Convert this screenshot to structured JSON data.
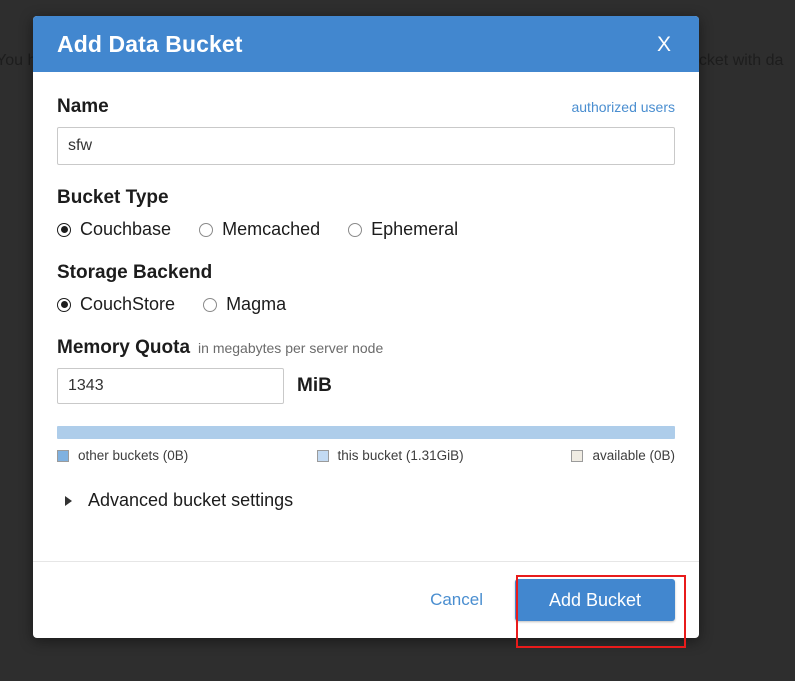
{
  "background": {
    "text_left": "You h",
    "text_right": "ucket with da",
    "overlay_color": "#2e2e2e"
  },
  "dialog": {
    "title": "Add Data Bucket",
    "close_label": "X",
    "header_color": "#4287cf",
    "name": {
      "label": "Name",
      "link_label": "authorized users",
      "value": "sfw",
      "placeholder": ""
    },
    "bucket_type": {
      "label": "Bucket Type",
      "selected": "Couchbase",
      "options": [
        {
          "label": "Couchbase",
          "checked": true
        },
        {
          "label": "Memcached",
          "checked": false
        },
        {
          "label": "Ephemeral",
          "checked": false
        }
      ]
    },
    "storage_backend": {
      "label": "Storage Backend",
      "selected": "CouchStore",
      "options": [
        {
          "label": "CouchStore",
          "checked": true
        },
        {
          "label": "Magma",
          "checked": false
        }
      ]
    },
    "memory_quota": {
      "label": "Memory Quota",
      "sublabel": "in megabytes per server node",
      "value": "1343",
      "unit": "MiB"
    },
    "memory_bar": {
      "segments": [
        {
          "key": "other_buckets",
          "label": "other buckets (0B)",
          "percent": 0,
          "color": "#7fb1e0"
        },
        {
          "key": "this_bucket",
          "label": "this bucket (1.31GiB)",
          "percent": 100,
          "color": "#aecdea"
        },
        {
          "key": "available",
          "label": "available (0B)",
          "percent": 0,
          "color": "#f0ece3"
        }
      ]
    },
    "advanced": {
      "label": "Advanced bucket settings",
      "expanded": false
    },
    "footer": {
      "cancel_label": "Cancel",
      "submit_label": "Add Bucket"
    }
  },
  "annotation": {
    "color": "#e81b1b",
    "target": "Add Bucket"
  }
}
